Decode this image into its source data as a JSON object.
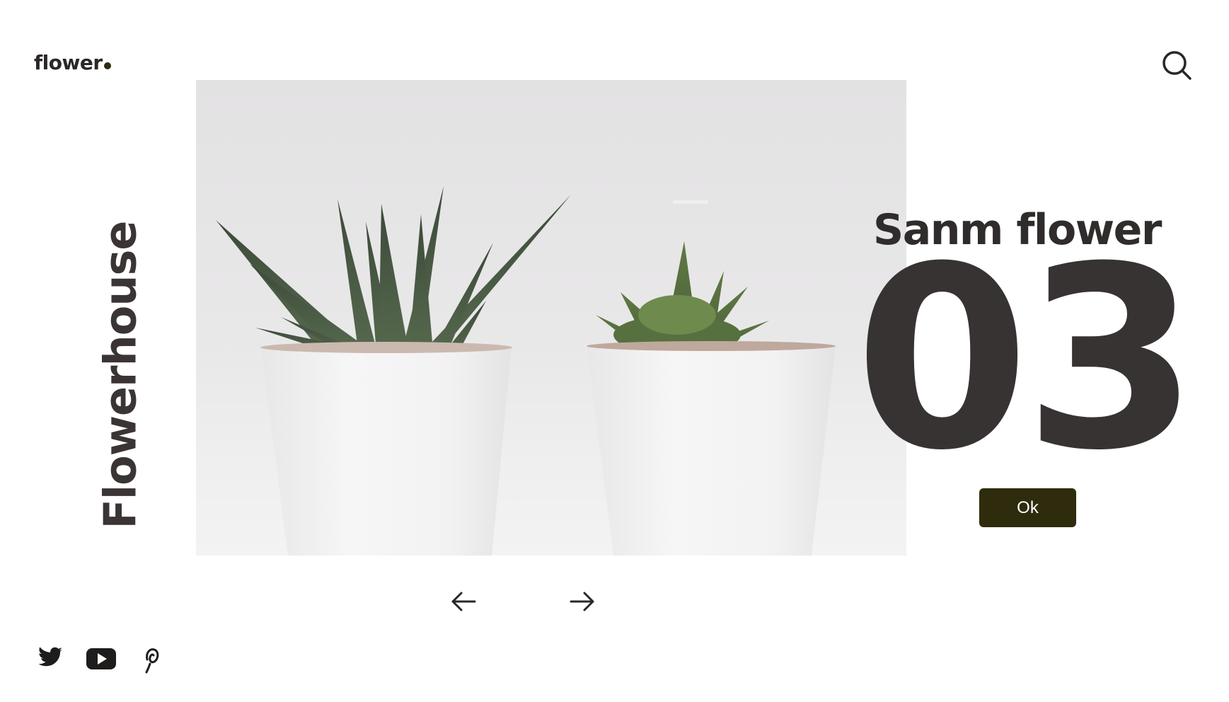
{
  "header": {
    "logo_text": "flower",
    "icons": [
      "search-icon"
    ]
  },
  "side": {
    "vertical_title": "Flowerhouse"
  },
  "slide": {
    "name": "Sanm flower",
    "number": "03",
    "cta_label": "Ok"
  },
  "carousel": {
    "icons": [
      "arrow-left-icon",
      "arrow-right-icon"
    ]
  },
  "social": {
    "icons": [
      "twitter-icon",
      "youtube-icon",
      "pinterest-icon"
    ]
  },
  "colors": {
    "text_dark": "#383333",
    "button_bg": "#2e2c0c",
    "button_text": "#ffffff",
    "hero_bg": "#e6e5e6"
  }
}
